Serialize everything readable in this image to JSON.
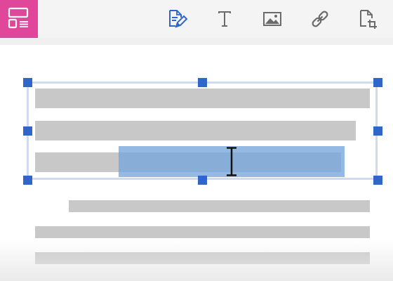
{
  "toolbar": {
    "accent_color": "#e0479a",
    "layout_icon": "layout-icon",
    "tools": [
      {
        "name": "edit-document-icon",
        "active": true,
        "color": "#2f66c8"
      },
      {
        "name": "text-tool-icon",
        "active": false,
        "color": "#6b6b6b"
      },
      {
        "name": "image-tool-icon",
        "active": false,
        "color": "#6b6b6b"
      },
      {
        "name": "link-tool-icon",
        "active": false,
        "color": "#6b6b6b"
      },
      {
        "name": "page-crop-icon",
        "active": false,
        "color": "#6b6b6b"
      }
    ]
  },
  "document": {
    "text_line_count": 6,
    "selected_block_line_count": 3,
    "handle_color": "#2f66c8",
    "frame_color": "#d0dbef",
    "highlight_color": "#76a6dc",
    "cursor_icon": "i-beam-cursor-icon"
  }
}
